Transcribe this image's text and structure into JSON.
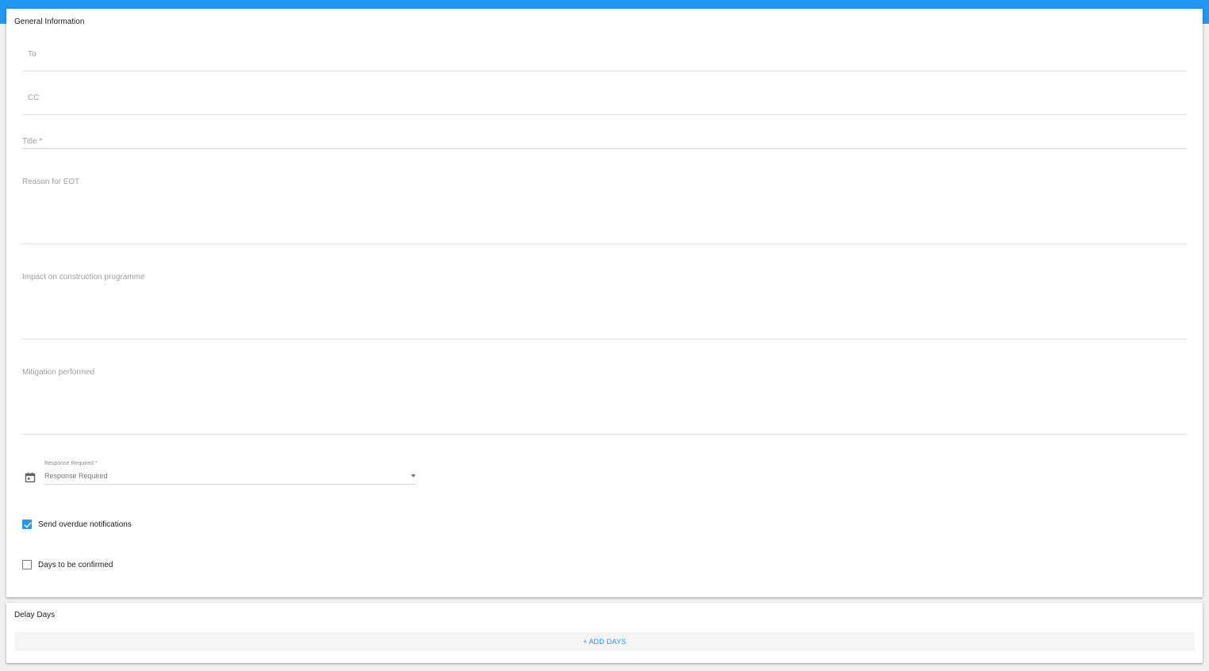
{
  "colors": {
    "accent": "#2196f3",
    "card_background": "#ffffff",
    "page_background": "#f0f0f0",
    "muted_label": "#9e9e9e"
  },
  "general_information": {
    "title": "General Information",
    "fields": {
      "to": {
        "label": "To"
      },
      "cc": {
        "label": "CC"
      },
      "title": {
        "label": "Title",
        "required_marker": "*"
      },
      "reason": {
        "label": "Reason for EOT"
      },
      "impact": {
        "label": "Impact on construction programme"
      },
      "mitigation": {
        "label": "Mitigation performed"
      }
    },
    "response_required": {
      "icon": "calendar-icon",
      "label": "Response Required",
      "required_marker": "*",
      "value": "Response Required"
    },
    "send_overdue_notifications": {
      "label": "Send overdue notifications",
      "checked": true
    },
    "days_to_be_confirmed": {
      "label": "Days to be confirmed",
      "checked": false
    }
  },
  "delay_days": {
    "title": "Delay Days",
    "add_days_label": "+ ADD DAYS"
  }
}
